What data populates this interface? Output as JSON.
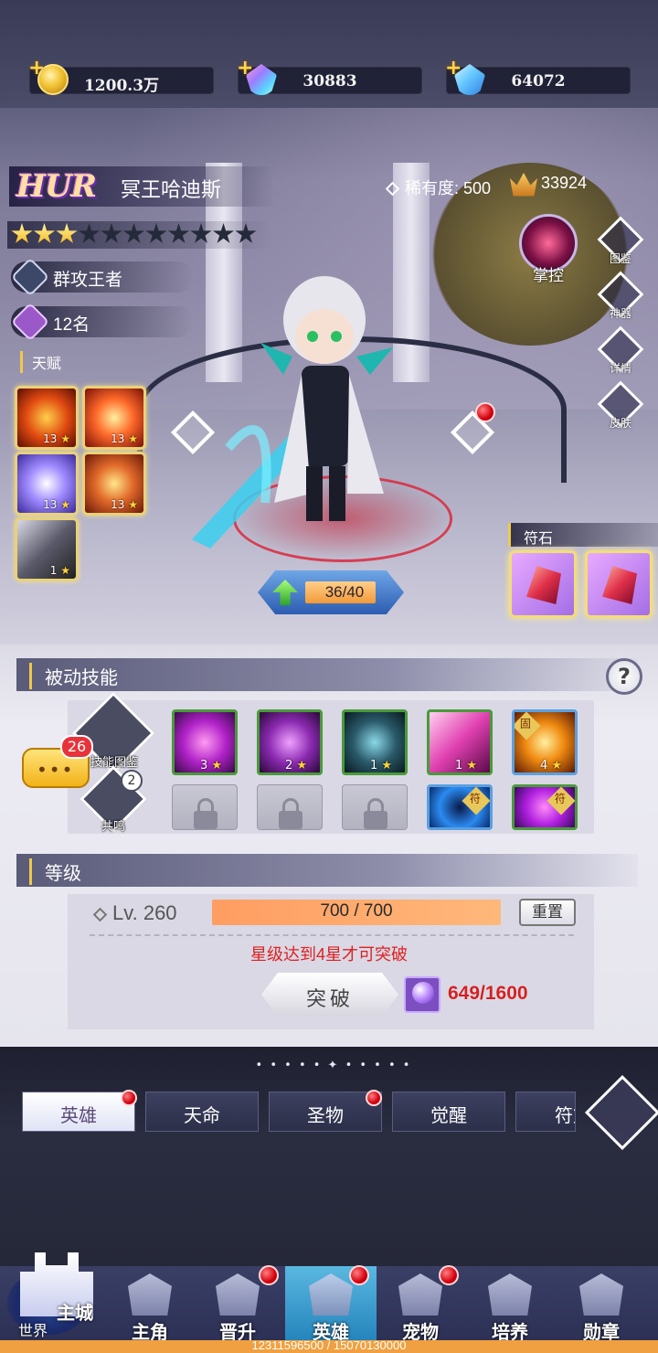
{
  "resources": [
    {
      "icon": "gold-coin-icon",
      "value": "1200.3万"
    },
    {
      "icon": "rainbow-gem-icon",
      "value": "30883"
    },
    {
      "icon": "blue-diamond-icon",
      "value": "64072"
    }
  ],
  "hero": {
    "grade": "HUR",
    "name": "冥王哈迪斯",
    "rarity_label": "稀有度:",
    "rarity_value": "500",
    "power": "33924",
    "stars_total": 11,
    "stars_lit": 3,
    "title": "群攻王者",
    "rank": "12名",
    "talent_label": "天赋",
    "talents": [
      {
        "icon": "fire-burst-icon",
        "level": "13"
      },
      {
        "icon": "flame-pillar-icon",
        "level": "13"
      },
      {
        "icon": "wind-slash-icon",
        "level": "13"
      },
      {
        "icon": "fire-sword-icon",
        "level": "13"
      },
      {
        "icon": "dark-blade-icon",
        "level": "1"
      }
    ],
    "control_label": "掌控",
    "exp_text": "36/40",
    "exp_fraction": 0.9
  },
  "side_buttons": [
    {
      "icon": "atlas-icon",
      "label": "图鉴"
    },
    {
      "icon": "artifact-icon",
      "label": "神器"
    },
    {
      "icon": "magnifier-icon",
      "label": "详情"
    },
    {
      "icon": "skin-icon",
      "label": "皮肤"
    }
  ],
  "runes": {
    "label": "符石",
    "count": 2
  },
  "passive": {
    "title": "被动技能",
    "help": "?",
    "atlas_label": "技能图鉴",
    "resonance_label": "共鸣",
    "resonance_count": "2",
    "chat_count": "26",
    "chat_dots": "•••",
    "skills": [
      {
        "icon": "shadow-dancer-icon",
        "level": "3"
      },
      {
        "icon": "purple-slash-icon",
        "level": "2"
      },
      {
        "icon": "dark-shard-icon",
        "level": "1"
      },
      {
        "icon": "pink-wave-icon",
        "level": "1"
      },
      {
        "icon": "golden-flame-icon",
        "level": "4",
        "tag": "固"
      }
    ],
    "row2_tags": [
      "符",
      "符"
    ]
  },
  "level": {
    "title": "等级",
    "lv_text": "Lv. 260",
    "bar_text": "700 / 700",
    "bar_fraction": 1.0,
    "reset_label": "重置",
    "notice": "星级达到4星才可突破",
    "break_label": "突破",
    "orb_count": "649/1600"
  },
  "tabs": [
    "英雄",
    "天命",
    "圣物",
    "觉醒",
    "符文"
  ],
  "tab_ornament": "• • • • • ✦ • • • • •",
  "nav": {
    "city_main": "主城",
    "city_world": "世界",
    "items": [
      "主角",
      "晋升",
      "英雄",
      "宠物",
      "培养",
      "勋章"
    ],
    "active": "英雄"
  },
  "footer_text": "12311596500 / 15070130000",
  "colors": {
    "accent_gold": "#f0c84a",
    "notice_red": "#e02020",
    "exp_orange": "#f29a38",
    "active_nav": "#1f7fb8"
  }
}
